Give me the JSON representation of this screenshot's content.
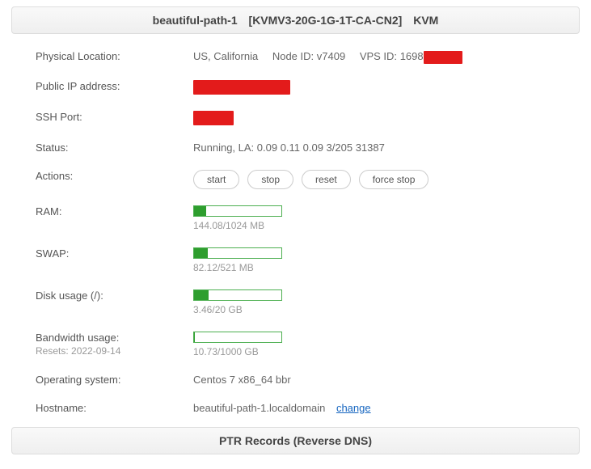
{
  "header": {
    "name": "beautiful-path-1",
    "plan": "[KVMV3-20G-1G-1T-CA-CN2]",
    "type": "KVM"
  },
  "location": {
    "label": "Physical Location:",
    "region": "US, California",
    "node_label": "Node ID:",
    "node_id": "v7409",
    "vps_label": "VPS ID:",
    "vps_id": "1698"
  },
  "public_ip": {
    "label": "Public IP address:"
  },
  "ssh_port": {
    "label": "SSH Port:"
  },
  "status": {
    "label": "Status:",
    "value": "Running, LA: 0.09 0.11 0.09 3/205 31387"
  },
  "actions": {
    "label": "Actions:",
    "start": "start",
    "stop": "stop",
    "reset": "reset",
    "force_stop": "force stop"
  },
  "ram": {
    "label": "RAM:",
    "text": "144.08/1024 MB",
    "percent": 14
  },
  "swap": {
    "label": "SWAP:",
    "text": "82.12/521 MB",
    "percent": 16
  },
  "disk": {
    "label": "Disk usage (/):",
    "text": "3.46/20 GB",
    "percent": 17
  },
  "bandwidth": {
    "label": "Bandwidth usage:",
    "reset_label": "Resets: 2022-09-14",
    "text": "10.73/1000 GB",
    "percent": 1
  },
  "os": {
    "label": "Operating system:",
    "value": "Centos 7 x86_64 bbr"
  },
  "hostname": {
    "label": "Hostname:",
    "value": "beautiful-path-1.localdomain",
    "change": "change"
  },
  "ptr_header": "PTR Records (Reverse DNS)"
}
